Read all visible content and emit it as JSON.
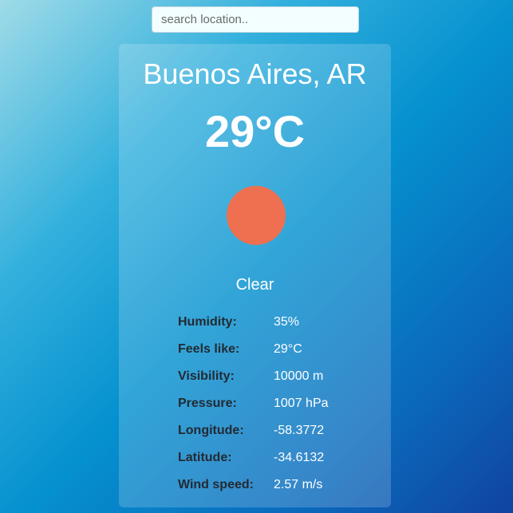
{
  "search": {
    "placeholder": "search location.."
  },
  "weather": {
    "location": "Buenos Aires, AR",
    "temperature": "29°C",
    "condition": "Clear",
    "icon": "sun-icon",
    "icon_color": "#ee7050",
    "details": [
      {
        "label": "Humidity:",
        "value": "35%"
      },
      {
        "label": "Feels like:",
        "value": "29°C"
      },
      {
        "label": "Visibility:",
        "value": "10000 m"
      },
      {
        "label": "Pressure:",
        "value": "1007 hPa"
      },
      {
        "label": "Longitude:",
        "value": "-58.3772"
      },
      {
        "label": "Latitude:",
        "value": "-34.6132"
      },
      {
        "label": "Wind speed:",
        "value": "2.57 m/s"
      }
    ]
  },
  "colors": {
    "background_start": "#9fdbe7",
    "background_end": "#1043a1",
    "label_text": "#232a33",
    "value_text": "#ffffff"
  }
}
